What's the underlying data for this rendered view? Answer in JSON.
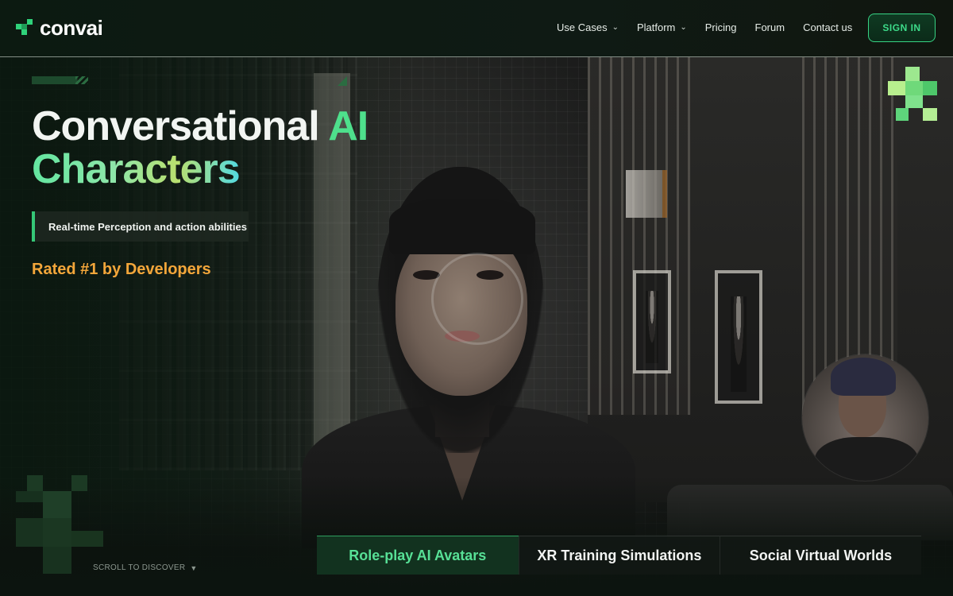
{
  "header": {
    "logo_text": "convai",
    "nav": [
      {
        "label": "Use Cases",
        "has_dropdown": true
      },
      {
        "label": "Platform",
        "has_dropdown": true
      },
      {
        "label": "Pricing",
        "has_dropdown": false
      },
      {
        "label": "Forum",
        "has_dropdown": false
      },
      {
        "label": "Contact us",
        "has_dropdown": false
      }
    ],
    "signin_label": "SIGN IN"
  },
  "hero": {
    "title_line1": "Conversational",
    "title_line1_accent": "AI",
    "title_line2": "Characters",
    "feature_pill": "Real-time Perception and action abilities",
    "rating": "Rated #1 by Developers"
  },
  "tabs": [
    {
      "label": "Role-play AI Avatars",
      "active": true
    },
    {
      "label": "XR Training Simulations",
      "active": false
    },
    {
      "label": "Social Virtual Worlds",
      "active": false
    }
  ],
  "scroll_hint": "SCROLL TO DISCOVER",
  "colors": {
    "accent_green": "#3ddc8a",
    "rating_orange": "#f3a63a",
    "background": "#0b130e"
  },
  "icons": {
    "logo": "convai-logo-icon",
    "dropdown": "chevron-down-icon",
    "scroll": "triangle-down-icon"
  }
}
